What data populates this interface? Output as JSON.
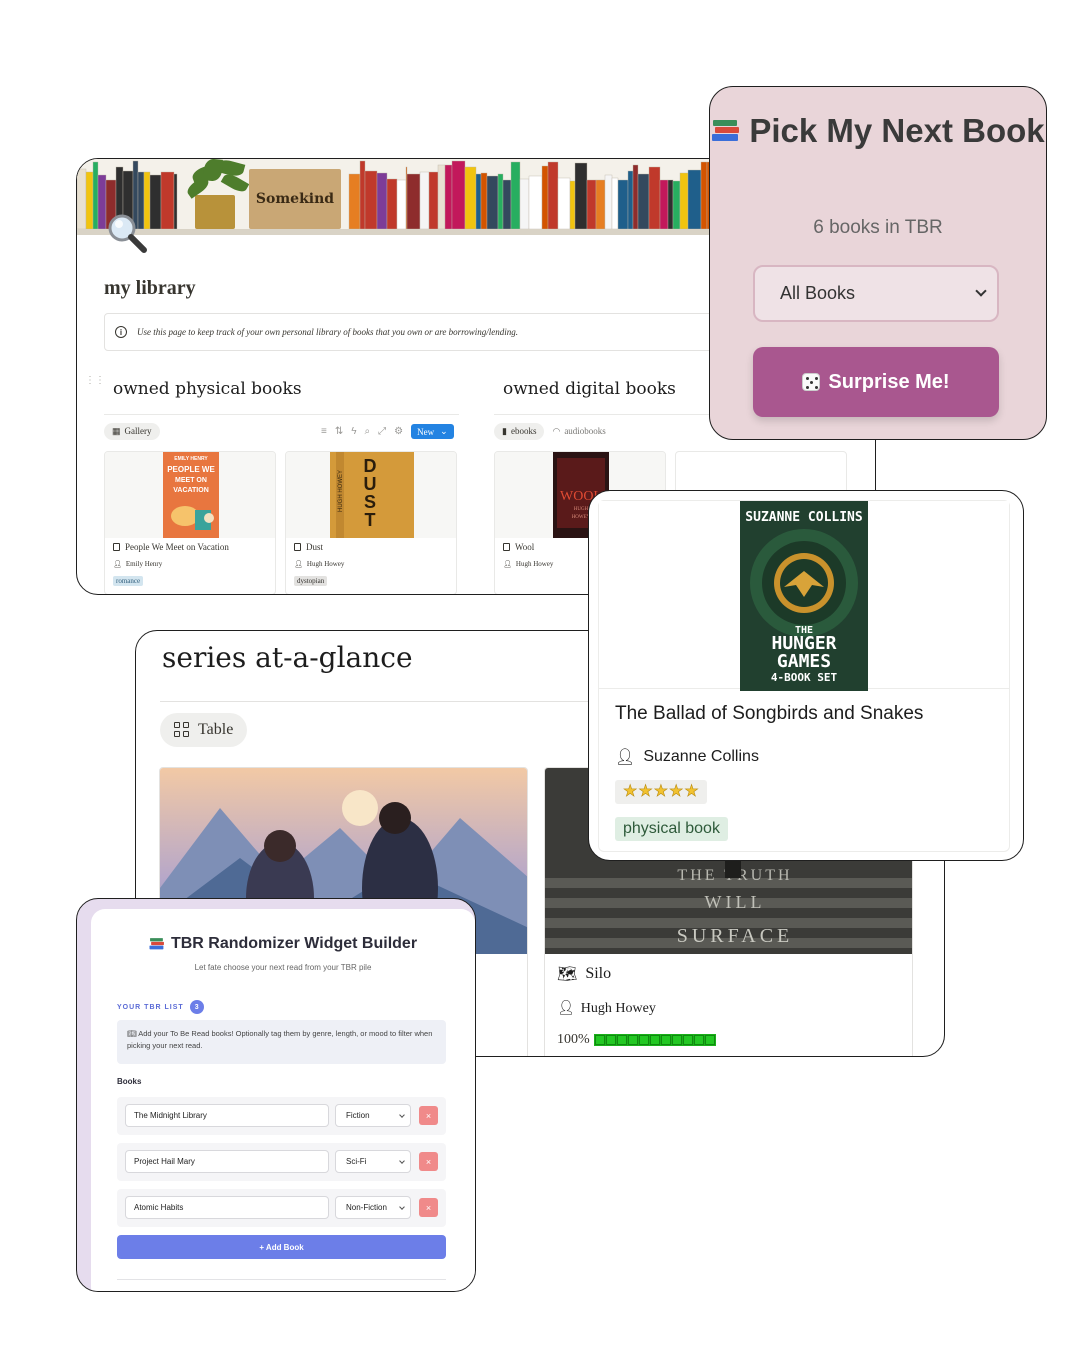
{
  "library": {
    "shelf_sign": "Somekind",
    "title": "my library",
    "callout": "Use this page to keep track of your own personal library of books that you own or are borrowing/lending.",
    "physical": {
      "title": "owned physical books",
      "view": "Gallery",
      "new_label": "New",
      "cards": [
        {
          "cover_text": "EMILY HENRY\nPEOPLE WE MEET ON VACATION",
          "title": "People We Meet on Vacation",
          "author": "Emily Henry",
          "tag": "romance",
          "tag_color": "#d3e5ef"
        },
        {
          "cover_text": "DUST",
          "cover_author": "HUGH HOWEY",
          "title": "Dust",
          "author": "Hugh Howey",
          "tag": "dystopian",
          "tag_color": "#e3e2e0"
        }
      ]
    },
    "digital": {
      "title": "owned digital books",
      "tabs": [
        "ebooks",
        "audiobooks"
      ],
      "cards": [
        {
          "cover_text": "WOOL",
          "title": "Wool",
          "author": "Hugh Howey"
        }
      ]
    }
  },
  "picker": {
    "title": "Pick My Next Book",
    "count": "6 books in TBR",
    "select_value": "All Books",
    "button": "Surprise Me!",
    "accent": "#a9578f",
    "background": "#e9d5d9"
  },
  "series": {
    "title": "series at-a-glance",
    "view": "Table",
    "card": {
      "cover_text": "THE TRUTH WILL SURFACE",
      "title": "Silo",
      "author": "Hugh Howey",
      "progress_label": "100%",
      "progress": 1.0
    }
  },
  "hunger_games": {
    "cover_author": "SUZANNE COLLINS",
    "cover_title": "THE HUNGER GAMES",
    "cover_subtitle": "4-BOOK SET",
    "title": "The Ballad of Songbirds and Snakes",
    "author": "Suzanne Collins",
    "rating": 5,
    "tag": "physical book"
  },
  "tbr": {
    "title": "TBR Randomizer Widget Builder",
    "subtitle": "Let fate choose your next read from your TBR pile",
    "list_label": "YOUR TBR LIST",
    "list_count": "3",
    "note": "Add your To Be Read books! Optionally tag them by genre, length, or mood to filter when picking your next read.",
    "books_label": "Books",
    "rows": [
      {
        "title": "The Midnight Library",
        "genre": "Fiction"
      },
      {
        "title": "Project Hail Mary",
        "genre": "Sci-Fi"
      },
      {
        "title": "Atomic Habits",
        "genre": "Non-Fiction"
      }
    ],
    "delete_glyph": "×",
    "add_button": "+ Add Book",
    "accent": "#6c7ee8"
  }
}
